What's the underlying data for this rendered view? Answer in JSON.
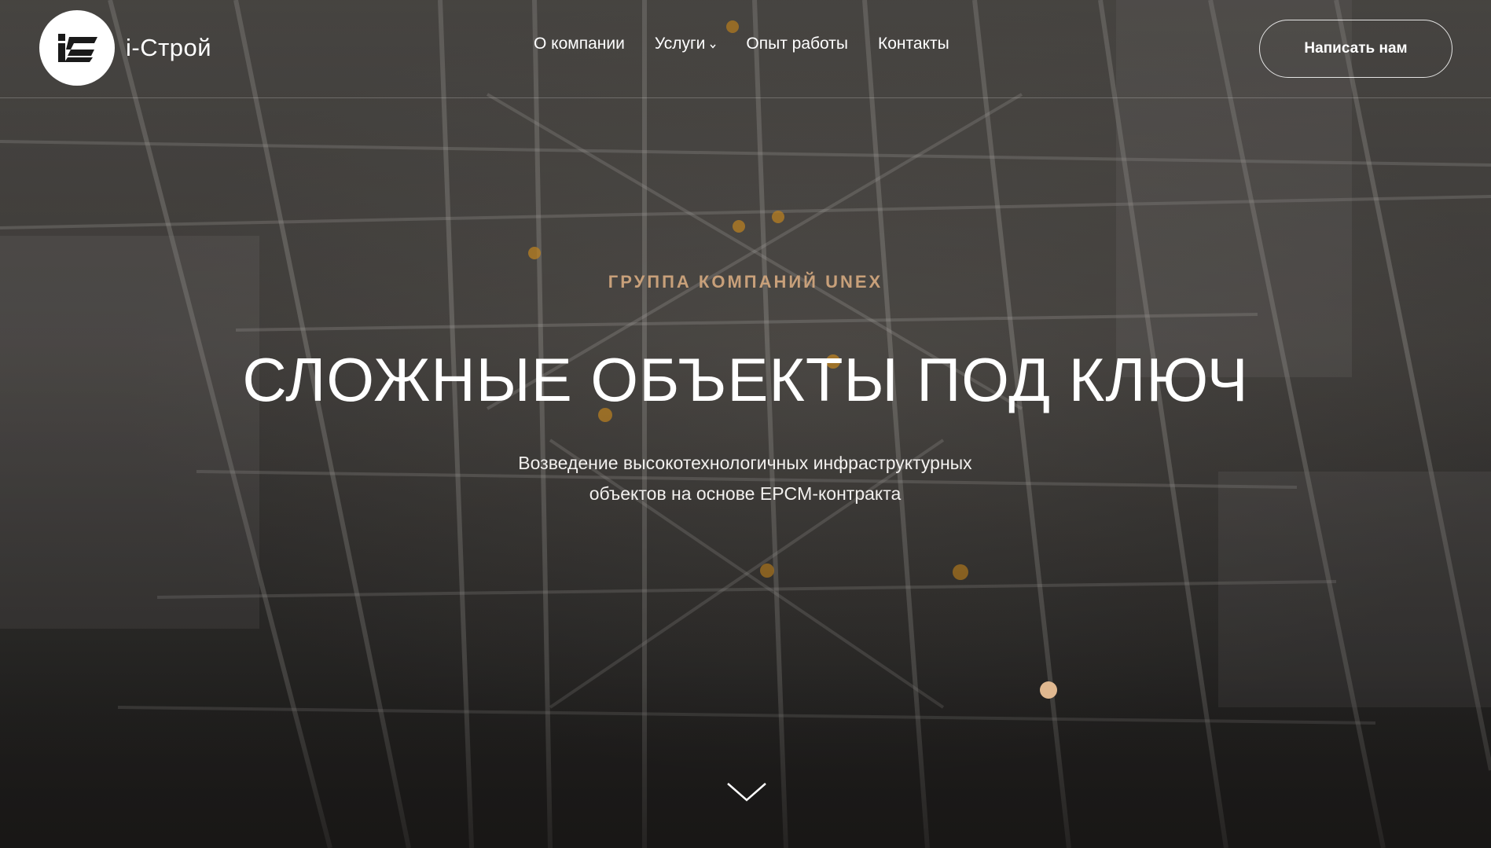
{
  "brand": {
    "mark_text": "iC",
    "name": "i-Строй"
  },
  "nav": {
    "items": [
      {
        "label": "О компании"
      },
      {
        "label": "Услуги",
        "has_dropdown": true
      },
      {
        "label": "Опыт работы"
      },
      {
        "label": "Контакты"
      }
    ]
  },
  "header": {
    "cta_label": "Написать нам"
  },
  "hero": {
    "eyebrow": "ГРУППА КОМПАНИЙ UNEX",
    "headline": "СЛОЖНЫЕ ОБЪЕКТЫ ПОД КЛЮЧ",
    "subtitle": "Возведение высокотехнологичных инфраструктурных объектов на основе EPCM-контракта"
  },
  "icons": {
    "dropdown": "chevron-down-icon",
    "scroll": "chevron-down-icon"
  },
  "colors": {
    "accent": "#c8a07a",
    "dot": "#e0b890",
    "text": "#ffffff"
  }
}
